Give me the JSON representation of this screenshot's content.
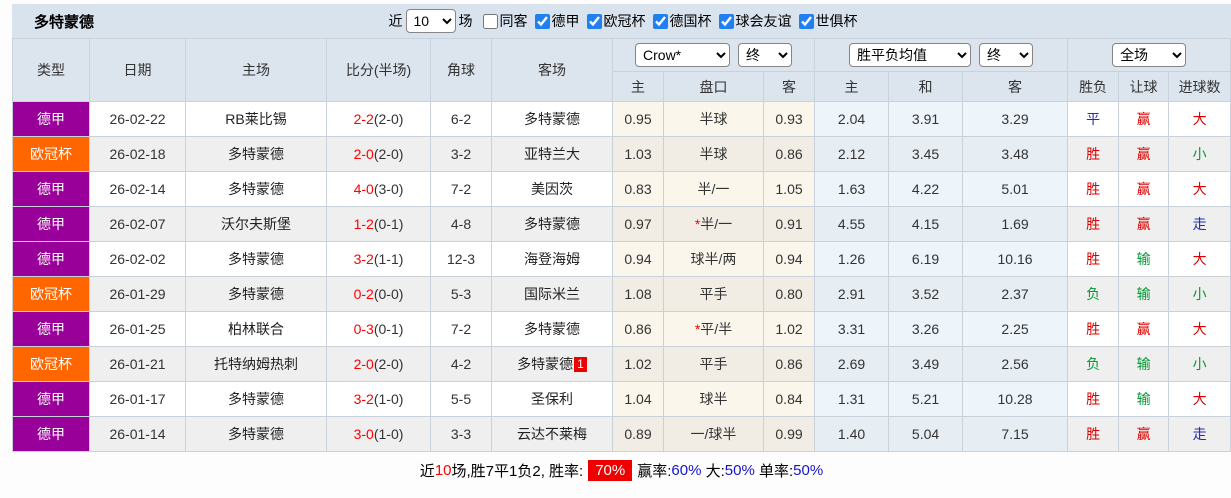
{
  "topbar": {
    "title": "多特蒙德",
    "recent_label": "近",
    "recent_value": "10",
    "unit_label": "场",
    "same_away": {
      "label": "同客",
      "checked": false
    },
    "leagues": [
      {
        "label": "德甲",
        "checked": true
      },
      {
        "label": "欧冠杯",
        "checked": true
      },
      {
        "label": "德国杯",
        "checked": true
      },
      {
        "label": "球会友谊",
        "checked": true
      },
      {
        "label": "世俱杯",
        "checked": true
      }
    ]
  },
  "odds_controls": {
    "bookmaker": "Crow*",
    "bookmaker_time": "终",
    "average": "胜平负均值",
    "average_time": "终",
    "scope": "全场"
  },
  "columns": {
    "type": "类型",
    "date": "日期",
    "home": "主场",
    "score": "比分(半场)",
    "corner": "角球",
    "away": "客场",
    "asia_home": "主",
    "handicap": "盘口",
    "asia_away": "客",
    "avg_home": "主",
    "avg_draw": "和",
    "avg_away": "客",
    "result": "胜负",
    "handicap_result": "让球",
    "goals": "进球数"
  },
  "colors": {
    "purple": "#990099",
    "orange": "#ff6600"
  },
  "rows": [
    {
      "league": "德甲",
      "lc": "purple",
      "date": "26-02-22",
      "home": "RB莱比锡",
      "hd": false,
      "score": "2-2",
      "half": "(2-0)",
      "corner": "6-2",
      "away": "多特蒙德",
      "ad": true,
      "badge": "",
      "a1": "0.95",
      "hcap": "半球",
      "star": false,
      "a2": "0.93",
      "m1": "2.04",
      "m2": "3.91",
      "m3": "3.29",
      "r1": {
        "t": "平",
        "c": "blue"
      },
      "r2": {
        "t": "赢",
        "c": "red"
      },
      "r3": {
        "t": "大",
        "c": "red"
      }
    },
    {
      "league": "欧冠杯",
      "lc": "orange",
      "date": "26-02-18",
      "home": "多特蒙德",
      "hd": true,
      "score": "2-0",
      "half": "(2-0)",
      "corner": "3-2",
      "away": "亚特兰大",
      "ad": false,
      "badge": "",
      "a1": "1.03",
      "hcap": "半球",
      "star": false,
      "a2": "0.86",
      "m1": "2.12",
      "m2": "3.45",
      "m3": "3.48",
      "r1": {
        "t": "胜",
        "c": "red"
      },
      "r2": {
        "t": "赢",
        "c": "red"
      },
      "r3": {
        "t": "小",
        "c": "green"
      }
    },
    {
      "league": "德甲",
      "lc": "purple",
      "date": "26-02-14",
      "home": "多特蒙德",
      "hd": true,
      "score": "4-0",
      "half": "(3-0)",
      "corner": "7-2",
      "away": "美因茨",
      "ad": false,
      "badge": "",
      "a1": "0.83",
      "hcap": "半/一",
      "star": false,
      "a2": "1.05",
      "m1": "1.63",
      "m2": "4.22",
      "m3": "5.01",
      "r1": {
        "t": "胜",
        "c": "red"
      },
      "r2": {
        "t": "赢",
        "c": "red"
      },
      "r3": {
        "t": "大",
        "c": "red"
      }
    },
    {
      "league": "德甲",
      "lc": "purple",
      "date": "26-02-07",
      "home": "沃尔夫斯堡",
      "hd": false,
      "score": "1-2",
      "half": "(0-1)",
      "corner": "4-8",
      "away": "多特蒙德",
      "ad": true,
      "badge": "",
      "a1": "0.97",
      "hcap": "半/一",
      "star": true,
      "a2": "0.91",
      "m1": "4.55",
      "m2": "4.15",
      "m3": "1.69",
      "r1": {
        "t": "胜",
        "c": "red"
      },
      "r2": {
        "t": "赢",
        "c": "red"
      },
      "r3": {
        "t": "走",
        "c": "blue"
      }
    },
    {
      "league": "德甲",
      "lc": "purple",
      "date": "26-02-02",
      "home": "多特蒙德",
      "hd": true,
      "score": "3-2",
      "half": "(1-1)",
      "corner": "12-3",
      "away": "海登海姆",
      "ad": false,
      "badge": "",
      "a1": "0.94",
      "hcap": "球半/两",
      "star": false,
      "a2": "0.94",
      "m1": "1.26",
      "m2": "6.19",
      "m3": "10.16",
      "r1": {
        "t": "胜",
        "c": "red"
      },
      "r2": {
        "t": "输",
        "c": "green"
      },
      "r3": {
        "t": "大",
        "c": "red"
      }
    },
    {
      "league": "欧冠杯",
      "lc": "orange",
      "date": "26-01-29",
      "home": "多特蒙德",
      "hd": true,
      "score": "0-2",
      "half": "(0-0)",
      "corner": "5-3",
      "away": "国际米兰",
      "ad": false,
      "badge": "",
      "a1": "1.08",
      "hcap": "平手",
      "star": false,
      "a2": "0.80",
      "m1": "2.91",
      "m2": "3.52",
      "m3": "2.37",
      "r1": {
        "t": "负",
        "c": "green"
      },
      "r2": {
        "t": "输",
        "c": "green"
      },
      "r3": {
        "t": "小",
        "c": "green"
      }
    },
    {
      "league": "德甲",
      "lc": "purple",
      "date": "26-01-25",
      "home": "柏林联合",
      "hd": false,
      "score": "0-3",
      "half": "(0-1)",
      "corner": "7-2",
      "away": "多特蒙德",
      "ad": true,
      "badge": "",
      "a1": "0.86",
      "hcap": "平/半",
      "star": true,
      "a2": "1.02",
      "m1": "3.31",
      "m2": "3.26",
      "m3": "2.25",
      "r1": {
        "t": "胜",
        "c": "red"
      },
      "r2": {
        "t": "赢",
        "c": "red"
      },
      "r3": {
        "t": "大",
        "c": "red"
      }
    },
    {
      "league": "欧冠杯",
      "lc": "orange",
      "date": "26-01-21",
      "home": "托特纳姆热刺",
      "hd": false,
      "score": "2-0",
      "half": "(2-0)",
      "corner": "4-2",
      "away": "多特蒙德",
      "ad": true,
      "badge": "1",
      "a1": "1.02",
      "hcap": "平手",
      "star": false,
      "a2": "0.86",
      "m1": "2.69",
      "m2": "3.49",
      "m3": "2.56",
      "r1": {
        "t": "负",
        "c": "green"
      },
      "r2": {
        "t": "输",
        "c": "green"
      },
      "r3": {
        "t": "小",
        "c": "green"
      }
    },
    {
      "league": "德甲",
      "lc": "purple",
      "date": "26-01-17",
      "home": "多特蒙德",
      "hd": true,
      "score": "3-2",
      "half": "(1-0)",
      "corner": "5-5",
      "away": "圣保利",
      "ad": false,
      "badge": "",
      "a1": "1.04",
      "hcap": "球半",
      "star": false,
      "a2": "0.84",
      "m1": "1.31",
      "m2": "5.21",
      "m3": "10.28",
      "r1": {
        "t": "胜",
        "c": "red"
      },
      "r2": {
        "t": "输",
        "c": "green"
      },
      "r3": {
        "t": "大",
        "c": "red"
      }
    },
    {
      "league": "德甲",
      "lc": "purple",
      "date": "26-01-14",
      "home": "多特蒙德",
      "hd": true,
      "score": "3-0",
      "half": "(1-0)",
      "corner": "3-3",
      "away": "云达不莱梅",
      "ad": false,
      "badge": "",
      "a1": "0.89",
      "hcap": "一/球半",
      "star": false,
      "a2": "0.99",
      "m1": "1.40",
      "m2": "5.04",
      "m3": "7.15",
      "r1": {
        "t": "胜",
        "c": "red"
      },
      "r2": {
        "t": "赢",
        "c": "red"
      },
      "r3": {
        "t": "走",
        "c": "blue"
      }
    }
  ],
  "summary": {
    "segments": [
      {
        "t": "近",
        "c": "black"
      },
      {
        "t": "10",
        "c": "red"
      },
      {
        "t": "场,胜7平1负2, 胜率:",
        "c": "black"
      },
      {
        "t": "70%",
        "c": "badge"
      },
      {
        "t": "赢率:",
        "c": "black"
      },
      {
        "t": "60%",
        "c": "blue"
      },
      {
        "t": " 大:",
        "c": "black"
      },
      {
        "t": "50%",
        "c": "blue"
      },
      {
        "t": " 单率:",
        "c": "black"
      },
      {
        "t": "50%",
        "c": "blue"
      }
    ]
  }
}
